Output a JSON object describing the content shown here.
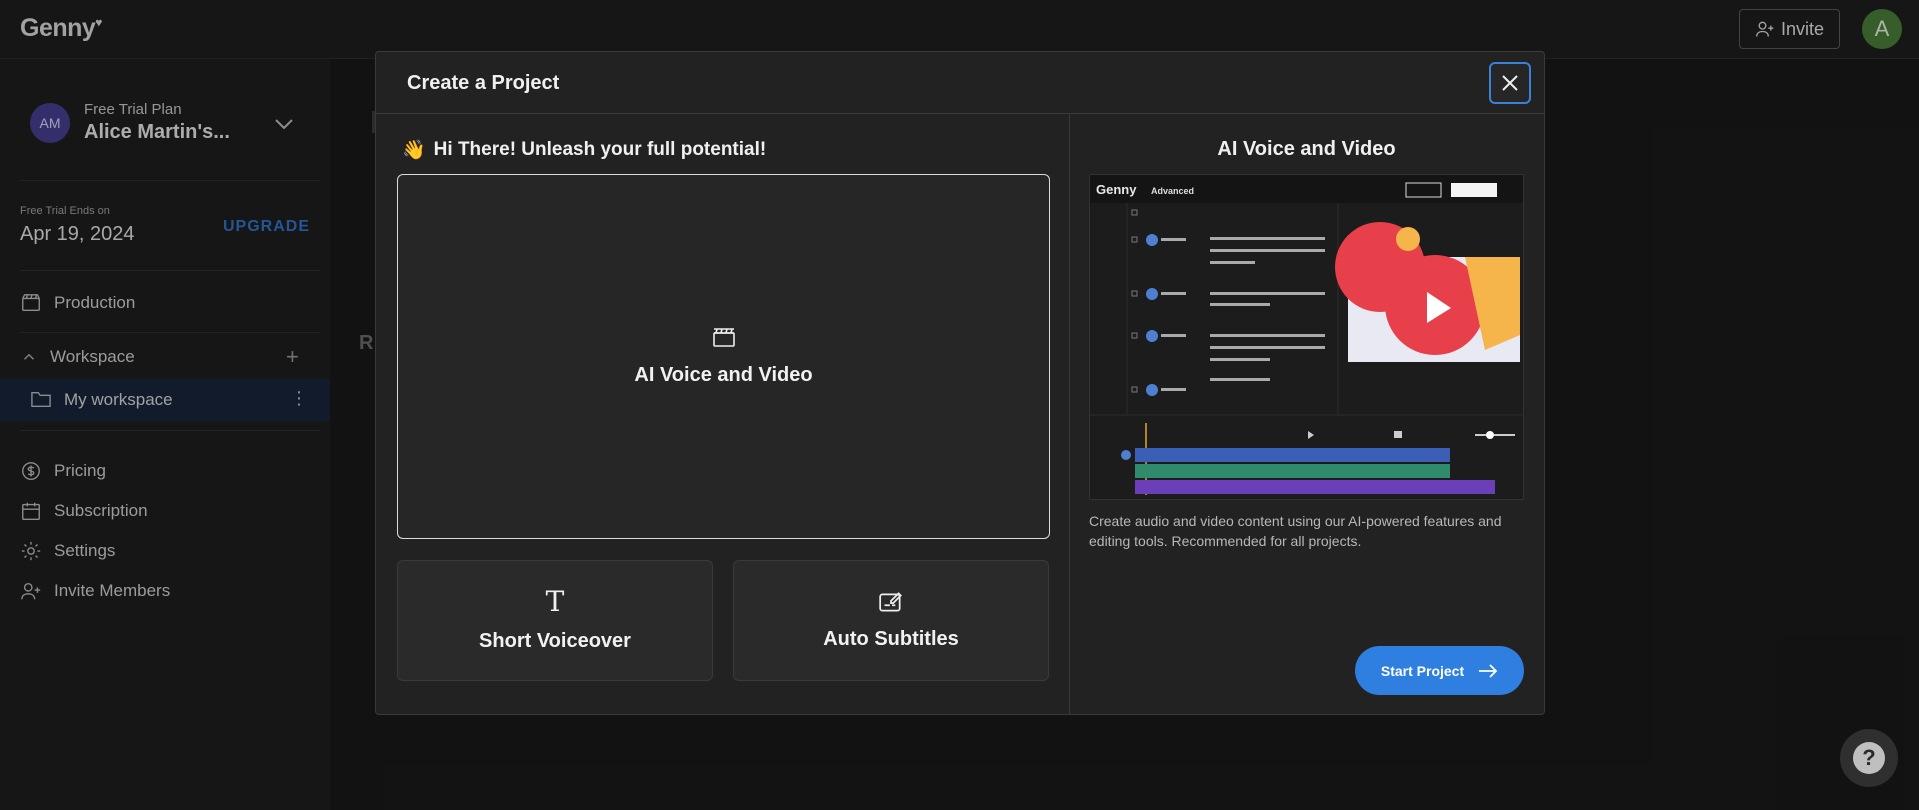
{
  "topbar": {
    "logo": "Genny",
    "invite_label": "Invite",
    "user_initial": "A"
  },
  "sidebar": {
    "plan_small": "Free Trial Plan",
    "account_initials": "AM",
    "account_name": "Alice Martin's...",
    "trial_label": "Free Trial Ends on",
    "trial_date": "Apr 19, 2024",
    "upgrade_label": "UPGRADE",
    "production_label": "Production",
    "workspace_label": "Workspace",
    "my_workspace_label": "My workspace",
    "items": [
      {
        "label": "Pricing",
        "icon": "dollar-circle-icon"
      },
      {
        "label": "Subscription",
        "icon": "calendar-icon"
      },
      {
        "label": "Settings",
        "icon": "gear-icon"
      },
      {
        "label": "Invite Members",
        "icon": "user-plus-icon"
      }
    ]
  },
  "background": {
    "ghost_letter": "R"
  },
  "modal": {
    "title": "Create a Project",
    "greeting_emoji": "👋",
    "greeting": "Hi There! Unleash your full potential!",
    "main_option": "AI Voice and Video",
    "option_short_voiceover": "Short Voiceover",
    "option_auto_subtitles": "Auto Subtitles",
    "right_title": "AI Voice and Video",
    "preview_logo": "Genny",
    "preview_tag": "Advanced",
    "description": "Create audio and video content using our AI-powered features and editing tools. Recommended for all projects.",
    "start_label": "Start Project"
  },
  "help_label": "?"
}
